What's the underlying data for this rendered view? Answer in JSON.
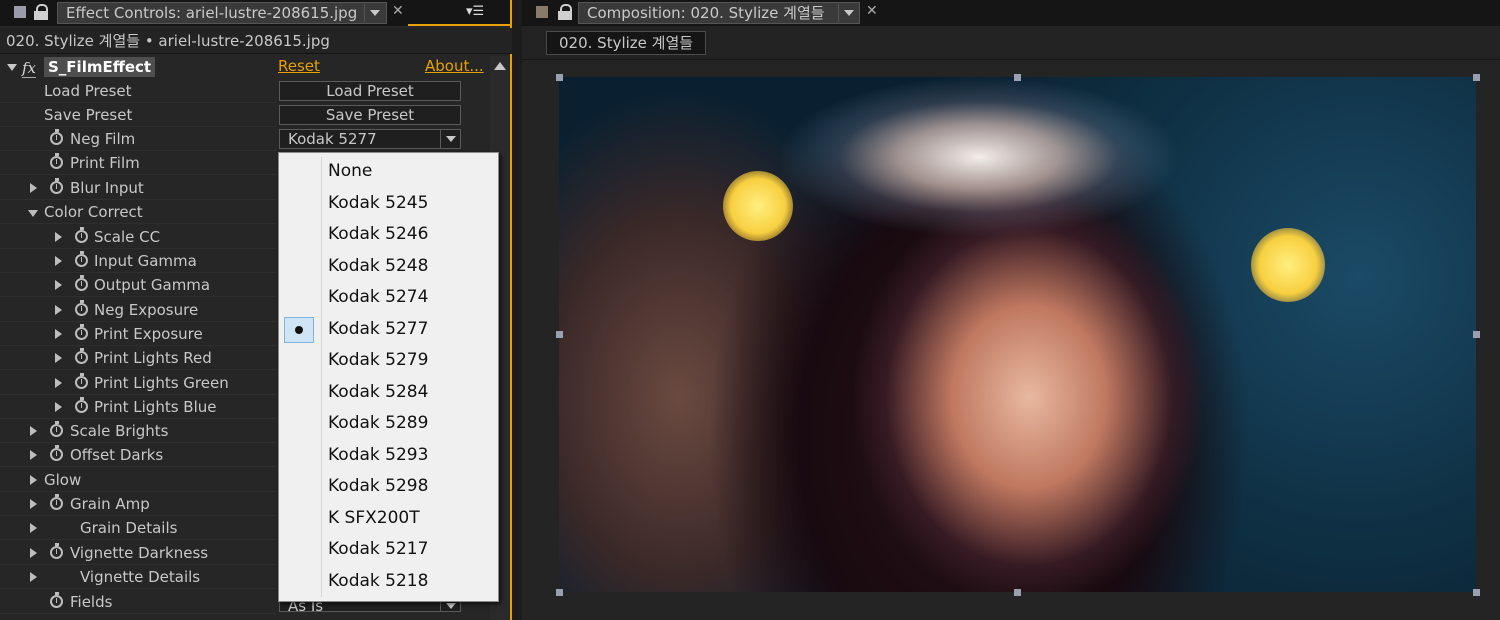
{
  "left_panel": {
    "tab_title": "Effect Controls: ariel-lustre-208615.jpg",
    "subheader": "020. Stylize 계열들 • ariel-lustre-208615.jpg",
    "effect": {
      "name": "S_FilmEffect",
      "fx_badge": "fx",
      "reset_label": "Reset",
      "about_label": "About..."
    },
    "properties": [
      {
        "label": "Load Preset"
      },
      {
        "label": "Save Preset"
      },
      {
        "label": "Neg Film"
      },
      {
        "label": "Print Film"
      },
      {
        "label": "Blur Input"
      },
      {
        "label": "Color Correct"
      },
      {
        "label": "Scale CC"
      },
      {
        "label": "Input Gamma"
      },
      {
        "label": "Output Gamma"
      },
      {
        "label": "Neg Exposure"
      },
      {
        "label": "Print Exposure"
      },
      {
        "label": "Print Lights Red"
      },
      {
        "label": "Print Lights Green"
      },
      {
        "label": "Print Lights Blue"
      },
      {
        "label": "Scale Brights"
      },
      {
        "label": "Offset Darks"
      },
      {
        "label": "Glow"
      },
      {
        "label": "Grain Amp"
      },
      {
        "label": "Grain Details"
      },
      {
        "label": "Vignette Darkness"
      },
      {
        "label": "Vignette Details"
      },
      {
        "label": "Fields"
      }
    ],
    "controls": {
      "load_preset_button": "Load Preset",
      "save_preset_button": "Save Preset",
      "neg_film_value": "Kodak 5277",
      "fields_value": "As Is"
    },
    "dropdown": {
      "options": [
        "None",
        "Kodak 5245",
        "Kodak 5246",
        "Kodak 5248",
        "Kodak 5274",
        "Kodak 5277",
        "Kodak 5279",
        "Kodak 5284",
        "Kodak 5289",
        "Kodak 5293",
        "Kodak 5298",
        "K SFX200T",
        "Kodak 5217",
        "Kodak 5218"
      ],
      "selected": "Kodak 5277"
    }
  },
  "right_panel": {
    "tab_title": "Composition: 020. Stylize 계열들",
    "comp_chip": "020. Stylize 계열들"
  },
  "colors": {
    "accent": "#e8a100",
    "panel_bg": "#262626",
    "dropdown_bg": "#f0f0f0",
    "selection": "#cfe5f5"
  }
}
